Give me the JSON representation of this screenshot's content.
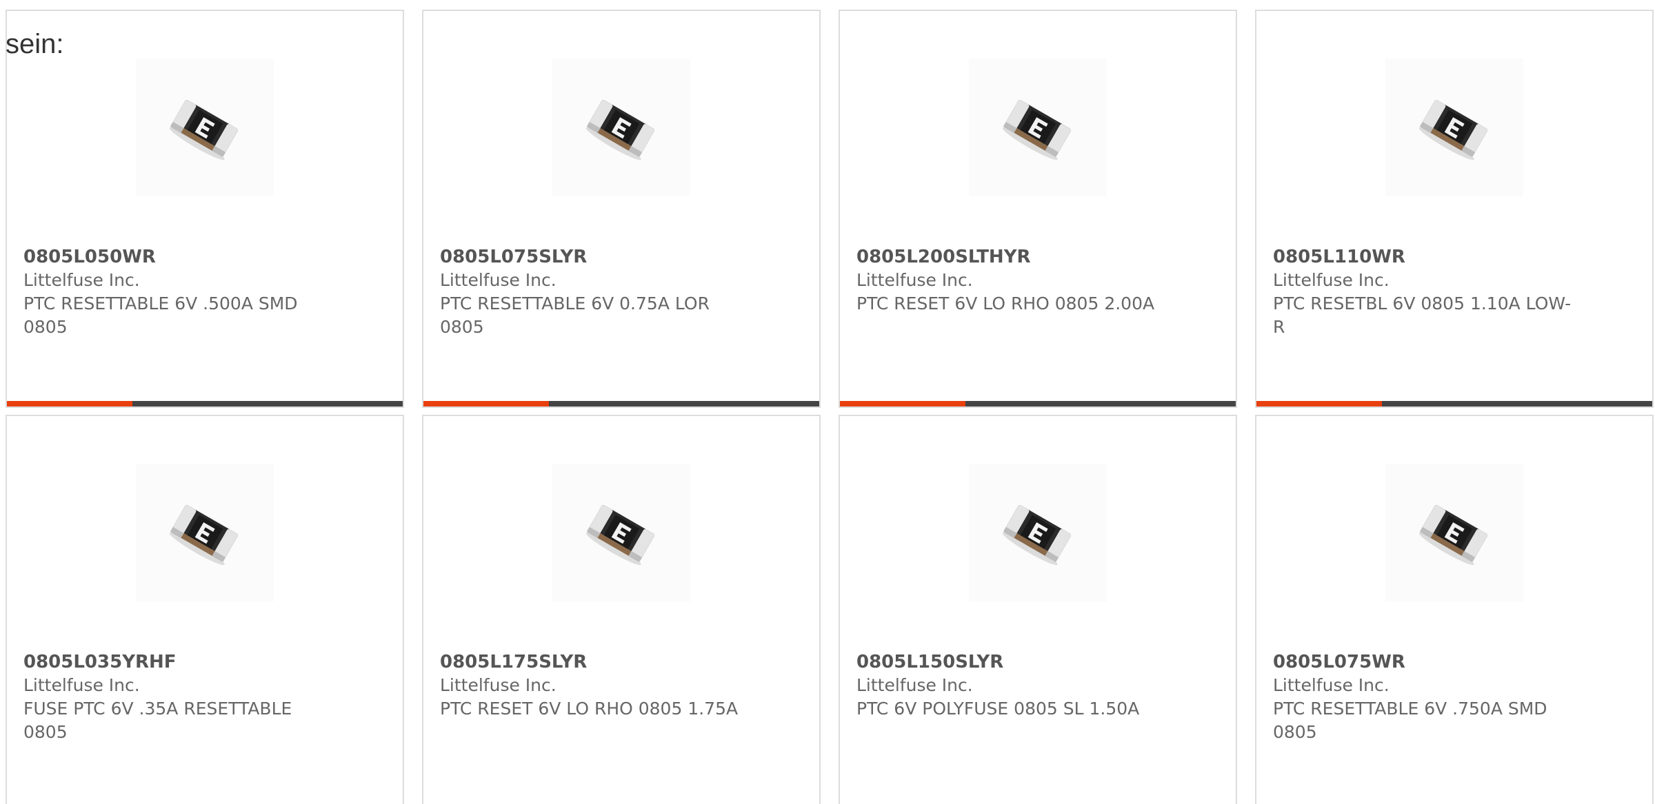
{
  "intro_text": "sein:",
  "accent_color": "#e8400f",
  "bar_color": "#444444",
  "product_icon": "smd-ptc-fuse-chip-image",
  "products": [
    {
      "part_number": "0805L050WR",
      "manufacturer": "Littelfuse Inc.",
      "description": "PTC RESETTABLE 6V .500A SMD 0805"
    },
    {
      "part_number": "0805L075SLYR",
      "manufacturer": "Littelfuse Inc.",
      "description": "PTC RESETTABLE 6V 0.75A LOR 0805"
    },
    {
      "part_number": "0805L200SLTHYR",
      "manufacturer": "Littelfuse Inc.",
      "description": "PTC RESET 6V LO RHO 0805 2.00A"
    },
    {
      "part_number": "0805L110WR",
      "manufacturer": "Littelfuse Inc.",
      "description": "PTC RESETBL 6V 0805 1.10A LOW-R"
    },
    {
      "part_number": "0805L035YRHF",
      "manufacturer": "Littelfuse Inc.",
      "description": "FUSE PTC 6V .35A RESETTABLE 0805"
    },
    {
      "part_number": "0805L175SLYR",
      "manufacturer": "Littelfuse Inc.",
      "description": "PTC RESET 6V LO RHO 0805 1.75A"
    },
    {
      "part_number": "0805L150SLYR",
      "manufacturer": "Littelfuse Inc.",
      "description": "PTC 6V POLYFUSE 0805 SL 1.50A"
    },
    {
      "part_number": "0805L075WR",
      "manufacturer": "Littelfuse Inc.",
      "description": "PTC RESETTABLE 6V .750A SMD 0805"
    }
  ]
}
